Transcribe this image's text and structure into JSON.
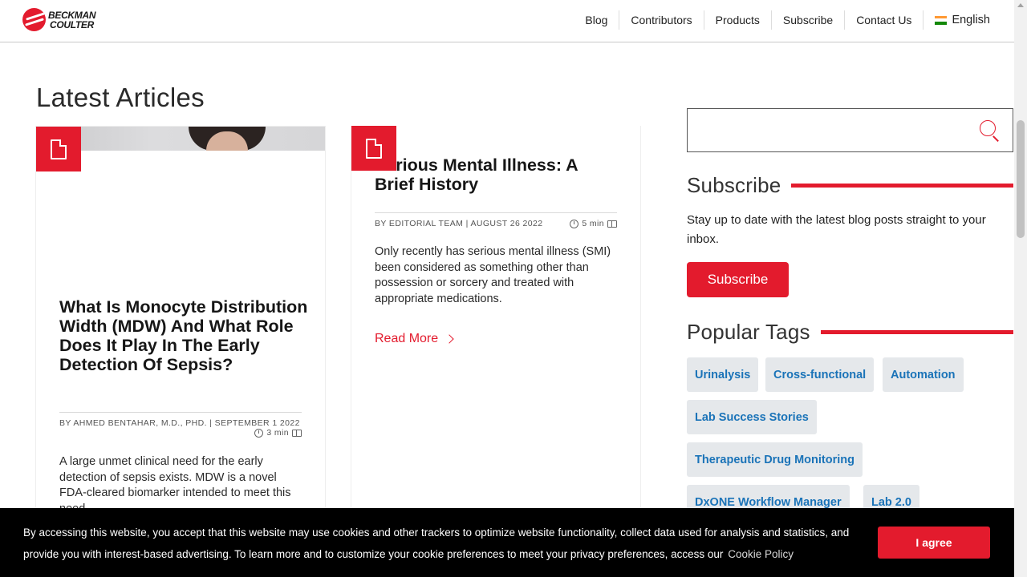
{
  "header": {
    "logo_line1": "BECKMAN",
    "logo_line2": "COULTER",
    "nav": [
      "Blog",
      "Contributors",
      "Products",
      "Subscribe",
      "Contact Us"
    ],
    "language": "English"
  },
  "main": {
    "section_title": "Latest Articles",
    "articles": [
      {
        "title": "What Is Monocyte Distribution Width (MDW) And What Role Does It Play In The Early Detection Of Sepsis?",
        "byline": "BY AHMED BENTAHAR, M.D., PHD.  | SEPTEMBER 1 2022",
        "read_time": "3 min",
        "excerpt": "A large unmet clinical need for the early detection of sepsis exists. MDW is a novel FDA-cleared biomarker intended to meet this need."
      },
      {
        "title": "Serious Mental Illness: A Brief History",
        "byline": "BY EDITORIAL TEAM  | AUGUST 26 2022",
        "read_time": "5 min",
        "excerpt": "Only recently has serious mental illness (SMI) been considered as something other than possession or sorcery and treated with appropriate medications.",
        "read_more": "Read More"
      }
    ]
  },
  "sidebar": {
    "search": {
      "value": "",
      "placeholder": ""
    },
    "subscribe": {
      "heading": "Subscribe",
      "text": "Stay up to date with the latest blog posts straight to your inbox.",
      "button": "Subscribe"
    },
    "tags": {
      "heading": "Popular Tags",
      "items": [
        "Urinalysis",
        "Cross-functional",
        "Automation",
        "Lab Success Stories",
        "Therapeutic Drug Monitoring",
        "DxONE Workflow Manager",
        "Lab 2.0"
      ]
    }
  },
  "cookie": {
    "text": "By accessing this website, you accept that this website may use cookies and other trackers to optimize website functionality, collect data used for analysis and statistics, and provide you with interest-based advertising. To learn more and to customize your cookie preferences to meet your privacy preferences, access our",
    "link": "Cookie Policy",
    "button": "I agree"
  },
  "colors": {
    "accent": "#e31b2d",
    "tag_bg": "#e5e8eb",
    "tag_text": "#1a73b8"
  }
}
